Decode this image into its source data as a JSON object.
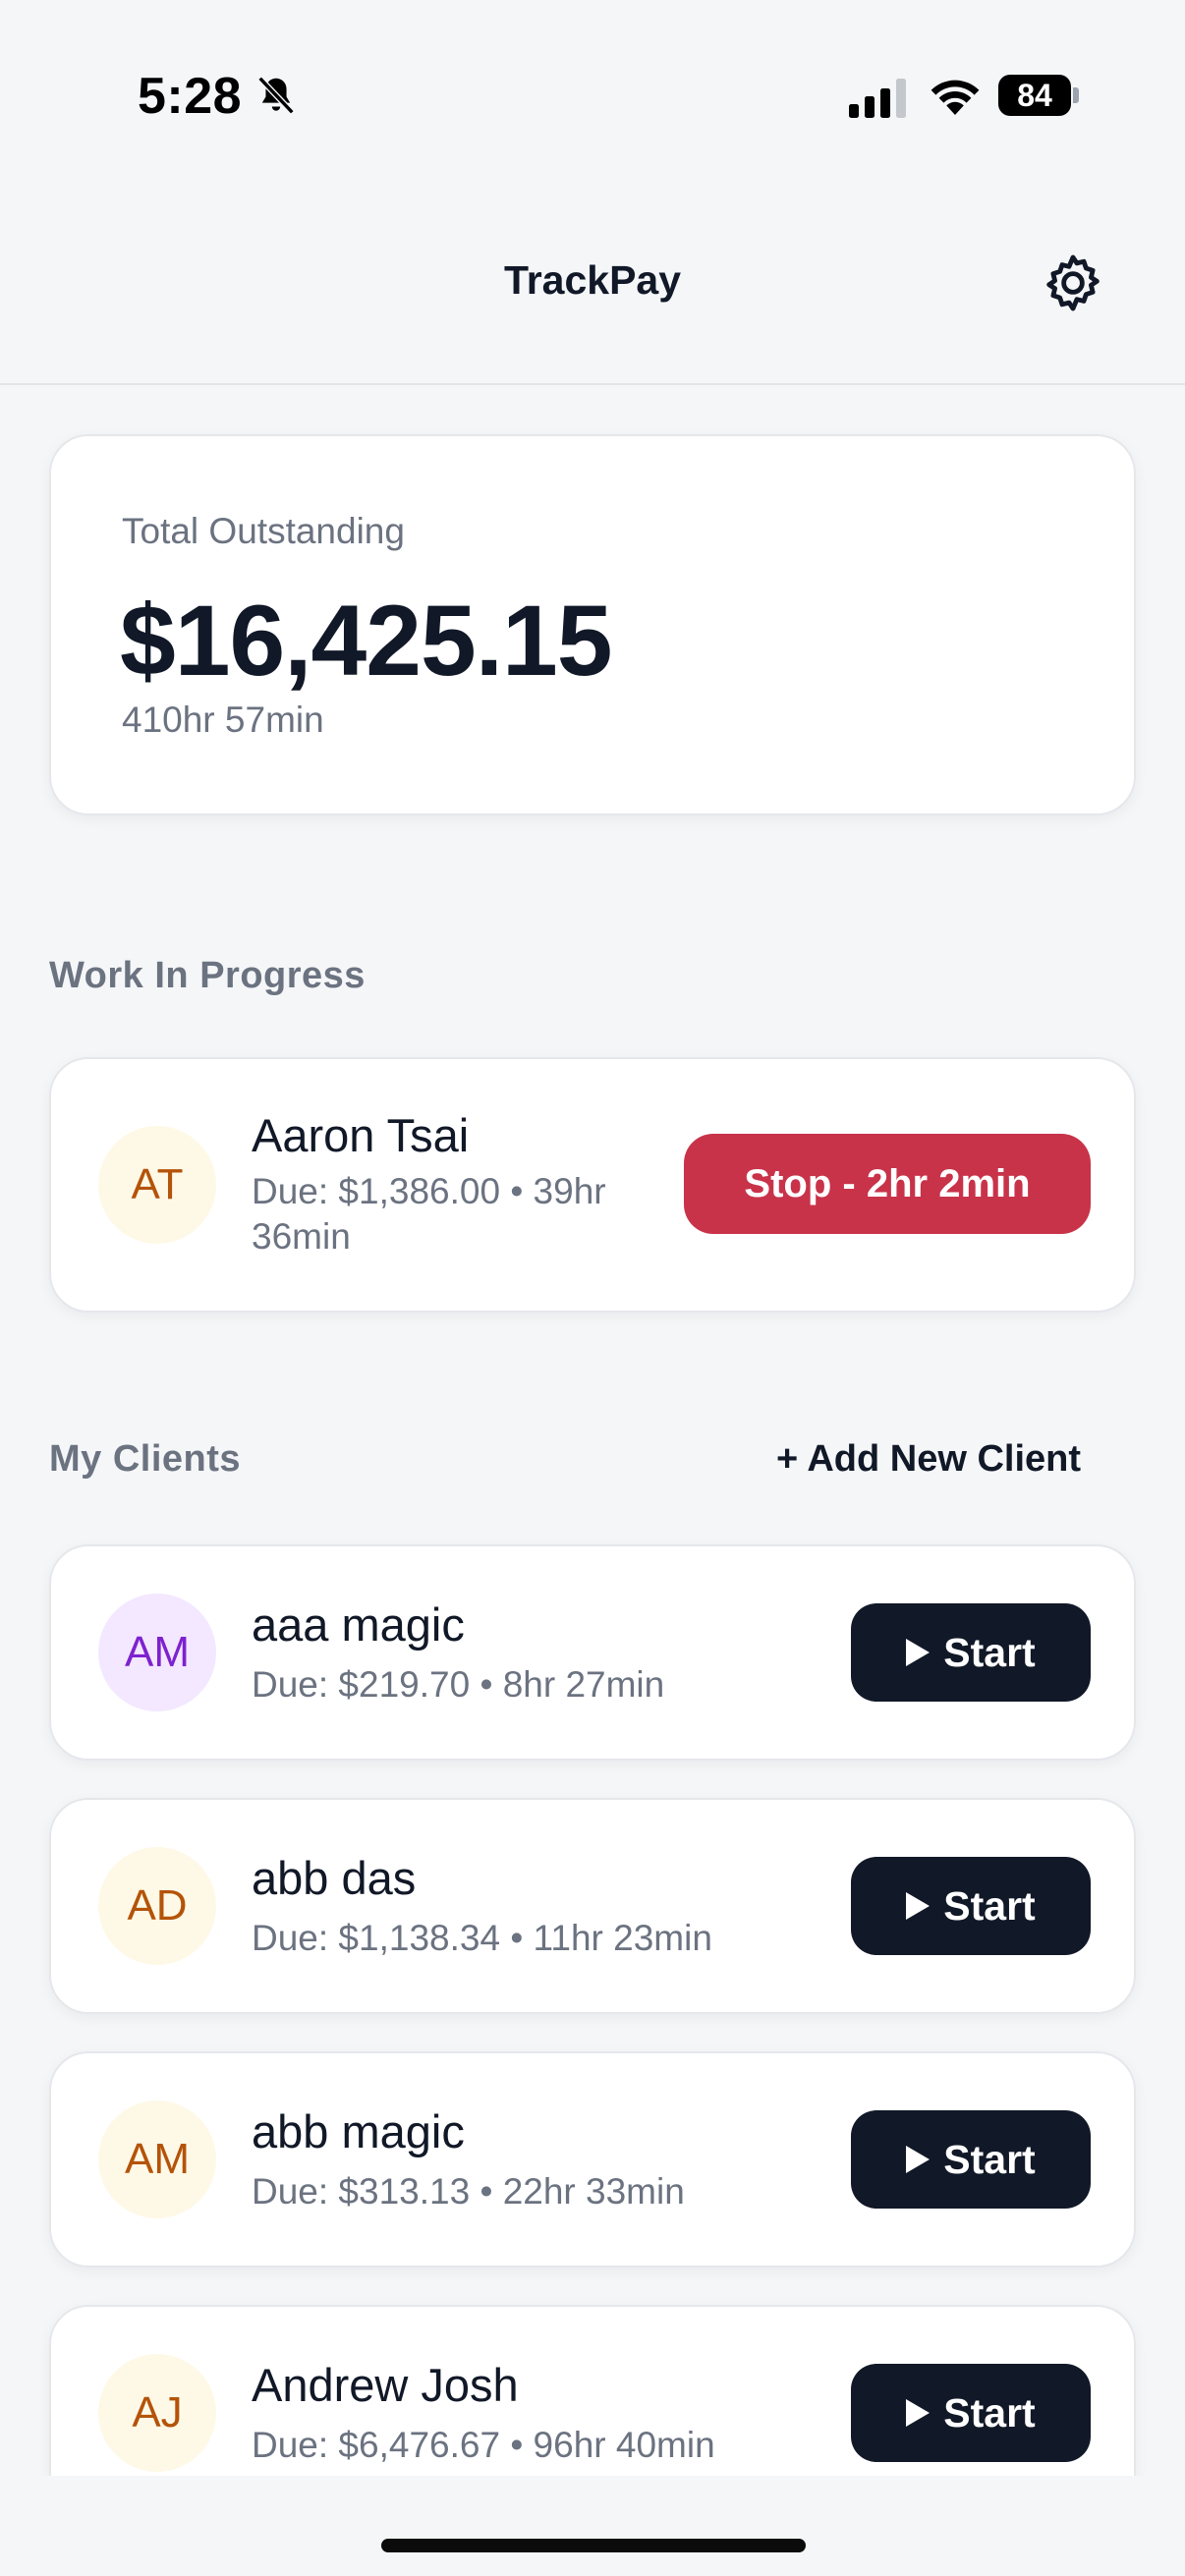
{
  "status_bar": {
    "time": "5:28",
    "battery": "84",
    "icons": [
      "bell-slash-icon",
      "signal-icon",
      "wifi-icon",
      "battery-icon"
    ]
  },
  "header": {
    "title": "TrackPay",
    "settings_icon": "gear-icon"
  },
  "summary": {
    "label": "Total Outstanding",
    "amount": "$16,425.15",
    "time": "410hr 57min"
  },
  "work_in_progress": {
    "label": "Work In Progress",
    "client": {
      "initials": "AT",
      "name": "Aaron Tsai",
      "meta": "Due: $1,386.00 • 39hr 36min",
      "stop_label": "Stop - 2hr 2min"
    }
  },
  "clients": {
    "label": "My Clients",
    "add_label": "+ Add New Client",
    "start_label": "Start",
    "items": [
      {
        "initials": "AM",
        "name": "aaa magic",
        "meta": "Due: $219.70 • 8hr 27min",
        "avatar_color": "purple"
      },
      {
        "initials": "AD",
        "name": "abb das",
        "meta": "Due: $1,138.34 • 11hr 23min",
        "avatar_color": "yellow"
      },
      {
        "initials": "AM",
        "name": "abb magic",
        "meta": "Due: $313.13 • 22hr 33min",
        "avatar_color": "yellow"
      },
      {
        "initials": "AJ",
        "name": "Andrew Josh",
        "meta": "Due: $6,476.67 • 96hr 40min",
        "avatar_color": "yellow"
      }
    ]
  },
  "colors": {
    "background": "#f5f6f8",
    "primary_dark": "#111827",
    "stop_red": "#c8334a",
    "muted_text": "#6b7280"
  }
}
